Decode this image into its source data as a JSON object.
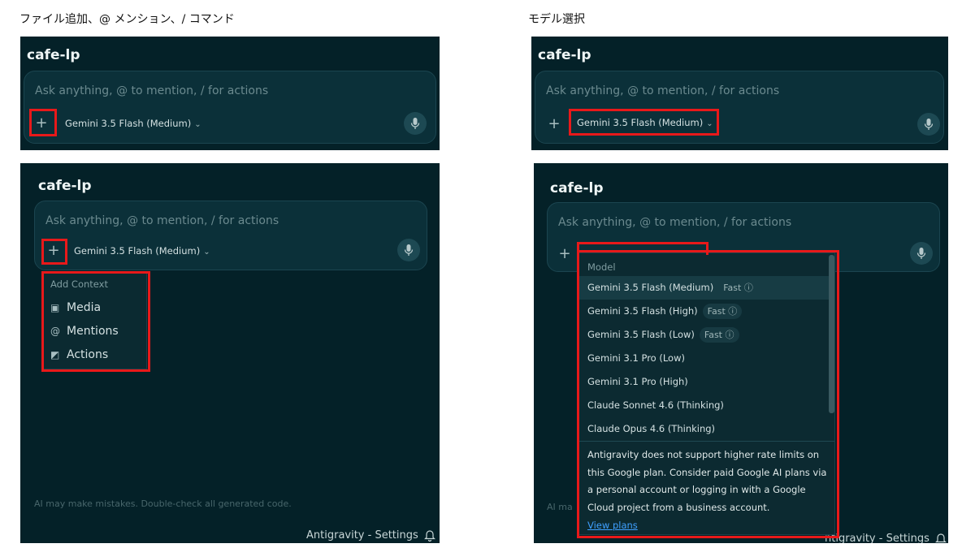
{
  "captions": {
    "left": "ファイル追加、@ メンション、/ コマンド",
    "right": "モデル選択"
  },
  "project_title": "cafe-lp",
  "input_placeholder": "Ask anything, @ to mention, / for actions",
  "model_selector": {
    "current": "Gemini 3.5 Flash (Medium)"
  },
  "add_context": {
    "header": "Add Context",
    "items": [
      {
        "label": "Media",
        "icon": "image-icon"
      },
      {
        "label": "Mentions",
        "icon": "at-icon"
      },
      {
        "label": "Actions",
        "icon": "slash-box-icon"
      }
    ]
  },
  "footer": {
    "disclaimer": "AI may make mistakes. Double-check all generated code.",
    "disclaimer_clipped": "AI ma",
    "status": "Antigravity - Settings",
    "status_clipped": "ntigravity - Settings"
  },
  "model_menu": {
    "header": "Model",
    "items": [
      {
        "label": "Gemini 3.5 Flash (Medium)",
        "badge": "Fast",
        "selected": true
      },
      {
        "label": "Gemini 3.5 Flash (High)",
        "badge": "Fast"
      },
      {
        "label": "Gemini 3.5 Flash (Low)",
        "badge": "Fast"
      },
      {
        "label": "Gemini 3.1 Pro (Low)"
      },
      {
        "label": "Gemini 3.1 Pro (High)"
      },
      {
        "label": "Claude Sonnet 4.6 (Thinking)"
      },
      {
        "label": "Claude Opus 4.6 (Thinking)"
      }
    ],
    "note": "Antigravity does not support higher rate limits on this Google plan. Consider paid Google AI plans via a personal account or logging in with a Google Cloud project from a business account.",
    "link": "View plans"
  },
  "colors": {
    "panel_bg": "#042128",
    "input_bg": "#0b3039",
    "highlight_red": "#e8191a",
    "link_blue": "#3fa0ff"
  }
}
